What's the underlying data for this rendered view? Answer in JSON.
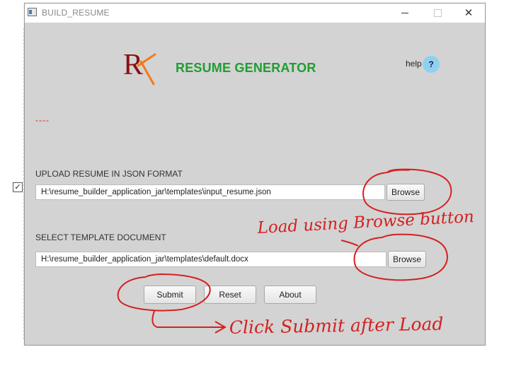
{
  "window": {
    "title": "BUILD_RESUME"
  },
  "header": {
    "logo_text": "R",
    "app_title": "RESUME GENERATOR",
    "help_label": "help",
    "help_button": "?"
  },
  "status": {
    "text": "----"
  },
  "json_section": {
    "label": "UPLOAD RESUME IN JSON FORMAT",
    "path_value": "H:\\resume_builder_application_jar\\templates\\input_resume.json",
    "browse_label": "Browse"
  },
  "template_section": {
    "label": "SELECT TEMPLATE DOCUMENT",
    "path_value": "H:\\resume_builder_application_jar\\templates\\default.docx",
    "browse_label": "Browse"
  },
  "actions": {
    "submit_label": "Submit",
    "reset_label": "Reset",
    "about_label": "About"
  },
  "annotations": {
    "browse_note": "Load using Browse button",
    "submit_note": "Click Submit after Load"
  },
  "stray_checkbox": {
    "checked": true
  },
  "colors": {
    "window_bg": "#d3d3d3",
    "title_green": "#1f9e32",
    "status_red": "#e02020",
    "annotation_red": "#d42020",
    "help_blue": "#8fd0f0",
    "logo_dark_red": "#8b1010",
    "logo_orange": "#f07b1a"
  },
  "icons": {
    "app_icon": "window-app-icon",
    "minimize": "minimize-icon",
    "maximize": "maximize-icon",
    "close": "close-icon"
  }
}
